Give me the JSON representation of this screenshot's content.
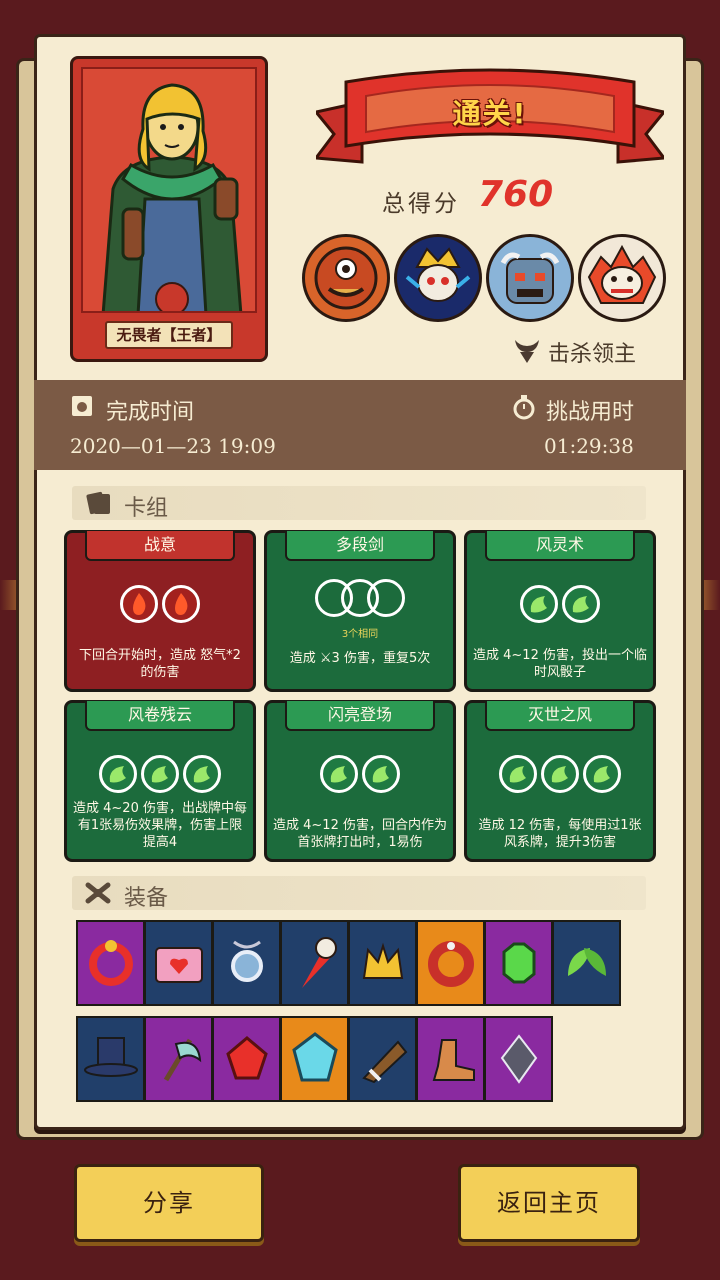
{
  "hero": {
    "name": "无畏者【王者】"
  },
  "banner": {
    "title": "通关!"
  },
  "score": {
    "label": "总得分",
    "value": "760"
  },
  "bosses": [
    {
      "name": "boss-cyclops"
    },
    {
      "name": "boss-skull-king"
    },
    {
      "name": "boss-robot"
    },
    {
      "name": "boss-mask"
    }
  ],
  "kill_boss_label": "击杀领主",
  "time": {
    "finish_label": "完成时间",
    "finish_value": "2020—01—23  19:09",
    "duration_label": "挑战用时",
    "duration_value": "01:29:38"
  },
  "deck": {
    "title": "卡组",
    "cards": [
      {
        "name": "战意",
        "color": "red",
        "orbs": 2,
        "orb_icon": "fire-icon",
        "desc": "下回合开始时，造成 怒气*2 的伤害"
      },
      {
        "name": "多段剑",
        "color": "green",
        "orbs": 3,
        "orb_icon": "empty-circle",
        "sub": "3个相同",
        "desc": "造成 ⚔3 伤害，重复5次"
      },
      {
        "name": "风灵术",
        "color": "green",
        "orbs": 2,
        "orb_icon": "wind-icon",
        "desc": "造成 4~12 伤害，投出一个临时风骰子"
      },
      {
        "name": "风卷残云",
        "color": "green",
        "orbs": 3,
        "orb_icon": "wind-icon",
        "desc": "造成 4~20 伤害，出战牌中每有1张易伤效果牌，伤害上限提高4"
      },
      {
        "name": "闪亮登场",
        "color": "green",
        "orbs": 2,
        "orb_icon": "wind-icon",
        "desc": "造成 4~12 伤害，回合内作为首张牌打出时，1易伤"
      },
      {
        "name": "灭世之风",
        "color": "green",
        "orbs": 3,
        "orb_icon": "wind-icon",
        "desc": "造成 12 伤害，每使用过1张风系牌，提升3伤害"
      }
    ]
  },
  "equipment": {
    "title": "装备",
    "row1": [
      {
        "icon": "red-ring-icon",
        "bg": "purple"
      },
      {
        "icon": "heart-box-icon",
        "bg": "blue"
      },
      {
        "icon": "amulet-icon",
        "bg": "blue"
      },
      {
        "icon": "skull-dagger-icon",
        "bg": "blue"
      },
      {
        "icon": "gold-crown-icon",
        "bg": "blue"
      },
      {
        "icon": "red-bracelet-icon",
        "bg": "orange"
      },
      {
        "icon": "green-gem-icon",
        "bg": "purple"
      },
      {
        "icon": "green-leaf-icon",
        "bg": "blue"
      }
    ],
    "row2": [
      {
        "icon": "top-hat-icon",
        "bg": "blue"
      },
      {
        "icon": "axe-icon",
        "bg": "purple"
      },
      {
        "icon": "red-gem-icon",
        "bg": "purple"
      },
      {
        "icon": "blue-crystal-icon",
        "bg": "orange"
      },
      {
        "icon": "horn-icon",
        "bg": "blue"
      },
      {
        "icon": "boots-icon",
        "bg": "purple"
      },
      {
        "icon": "dark-crystal-icon",
        "bg": "purple"
      }
    ]
  },
  "buttons": {
    "share": "分享",
    "home": "返回主页"
  },
  "colors": {
    "background": "#5a1a1e",
    "paper": "#f6ecd2",
    "score": "#e0332b",
    "card_red": "#8e1f22",
    "card_green": "#1c6b3c",
    "button": "#f3cf58"
  }
}
